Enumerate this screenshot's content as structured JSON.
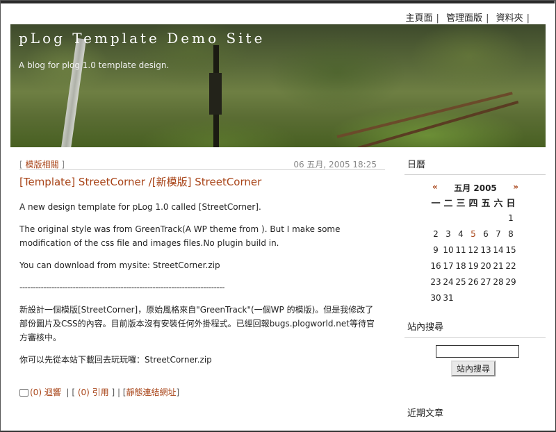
{
  "nav": {
    "items": [
      "主頁面",
      "管理面版",
      "資料夾"
    ],
    "separator": "|"
  },
  "header": {
    "title": "pLog Template Demo Site",
    "subtitle": "A blog for plog 1.0 template design."
  },
  "post": {
    "category": "模版相關",
    "date": "06 五月, 2005 18:25",
    "title": "[Template] StreetCorner /[新模版] StreetCorner",
    "paragraphs": [
      "A new design template for pLog 1.0 called [StreetCorner].",
      "The original style was from GreenTrack(A WP theme from ). But I make some modification of the css file and images files.No plugin build in.",
      "You can download from mysite: StreetCorner.zip",
      "-----------------------------------------------------------------------------",
      "新設計一個模版[StreetCorner]，原始風格來自\"GreenTrack\"(一個WP 的模版)。但是我修改了部份圖片及CSS的內容。目前版本沒有安裝任何外掛程式。已經回報bugs.plogworld.net等待官方審核中。",
      "你可以先從本站下載回去玩玩囉：StreetCorner.zip"
    ],
    "footer": {
      "comments": "(0) 迴響",
      "trackbacks": "(0) 引用",
      "permalink": "靜態連結網址"
    }
  },
  "sidebar": {
    "calendar": {
      "heading": "日曆",
      "prev": "«",
      "next": "»",
      "month_label": "五月 2005",
      "weekdays": [
        "一",
        "二",
        "三",
        "四",
        "五",
        "六",
        "日"
      ],
      "weeks": [
        [
          "",
          "",
          "",
          "",
          "",
          "",
          "1"
        ],
        [
          "2",
          "3",
          "4",
          "5",
          "6",
          "7",
          "8"
        ],
        [
          "9",
          "10",
          "11",
          "12",
          "13",
          "14",
          "15"
        ],
        [
          "16",
          "17",
          "18",
          "19",
          "20",
          "21",
          "22"
        ],
        [
          "23",
          "24",
          "25",
          "26",
          "27",
          "28",
          "29"
        ],
        [
          "30",
          "31",
          "",
          "",
          "",
          "",
          ""
        ]
      ],
      "highlighted_day": "5"
    },
    "search": {
      "heading": "站內搜尋",
      "input_value": "",
      "button_label": "站內搜尋"
    },
    "recent": {
      "heading": "近期文章"
    }
  },
  "colors": {
    "link": "#a84418",
    "border": "#cfcfcf"
  }
}
